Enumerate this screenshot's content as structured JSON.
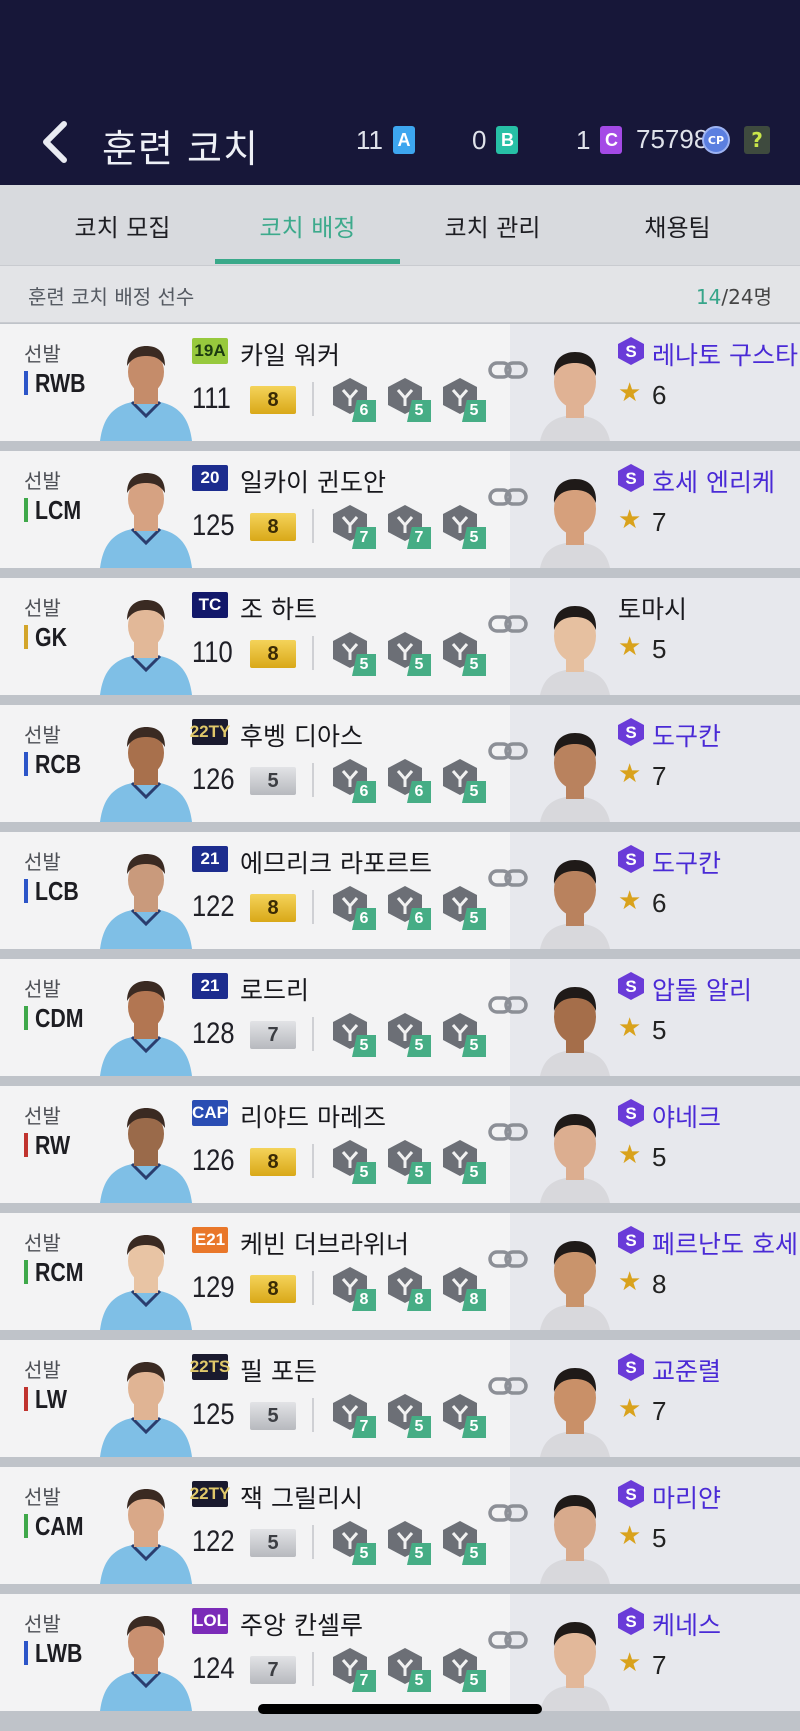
{
  "header": {
    "title": "훈련 코치",
    "currencies": [
      {
        "amount": "11",
        "token": "A"
      },
      {
        "amount": "0",
        "token": "B"
      },
      {
        "amount": "1",
        "token": "C"
      }
    ],
    "cp_amount": "75798",
    "cp_label": "CP",
    "help_label": "?"
  },
  "tabs": [
    "코치 모집",
    "코치 배정",
    "코치 관리",
    "채용팀"
  ],
  "active_tab": "코치 배정",
  "subbar": {
    "label": "훈련 코치 배정 선수",
    "assigned": "14",
    "total": "/24명"
  },
  "status_label": "선발",
  "players": [
    {
      "pos": "RWB",
      "pos_color": "#2c55c8",
      "season": "19A",
      "season_bg": "#97c93d",
      "season_fg": "#1b3a10",
      "name": "카일 워커",
      "ovr": "111",
      "level": "8",
      "level_type": "gold",
      "skills": [
        "6",
        "5",
        "5"
      ],
      "coach": "레나토 구스타",
      "coach_special": true,
      "coach_rating": "6"
    },
    {
      "pos": "LCM",
      "pos_color": "#3fa84a",
      "season": "20",
      "season_bg": "#1c2c8e",
      "season_fg": "#ffffff",
      "name": "일카이 귄도안",
      "ovr": "125",
      "level": "8",
      "level_type": "gold",
      "skills": [
        "7",
        "7",
        "5"
      ],
      "coach": "호세 엔리케",
      "coach_special": true,
      "coach_rating": "7"
    },
    {
      "pos": "GK",
      "pos_color": "#d3a52a",
      "season": "TC",
      "season_bg": "#12186a",
      "season_fg": "#ffffff",
      "name": "조 하트",
      "ovr": "110",
      "level": "8",
      "level_type": "gold",
      "skills": [
        "5",
        "5",
        "5"
      ],
      "coach": "토마시",
      "coach_special": false,
      "coach_rating": "5"
    },
    {
      "pos": "RCB",
      "pos_color": "#2c55c8",
      "season": "22TY",
      "season_bg": "#1a1a2e",
      "season_fg": "#e0c86a",
      "name": "후벵 디아스",
      "ovr": "126",
      "level": "5",
      "level_type": "silver",
      "skills": [
        "6",
        "6",
        "5"
      ],
      "coach": "도구칸",
      "coach_special": true,
      "coach_rating": "7"
    },
    {
      "pos": "LCB",
      "pos_color": "#2c55c8",
      "season": "21",
      "season_bg": "#1c2c8e",
      "season_fg": "#ffffff",
      "name": "에므리크 라포르트",
      "ovr": "122",
      "level": "8",
      "level_type": "gold",
      "skills": [
        "6",
        "6",
        "5"
      ],
      "coach": "도구칸",
      "coach_special": true,
      "coach_rating": "6"
    },
    {
      "pos": "CDM",
      "pos_color": "#3fa84a",
      "season": "21",
      "season_bg": "#1c2c8e",
      "season_fg": "#ffffff",
      "name": "로드리",
      "ovr": "128",
      "level": "7",
      "level_type": "silver",
      "skills": [
        "5",
        "5",
        "5"
      ],
      "coach": "압둘 알리",
      "coach_special": true,
      "coach_rating": "5"
    },
    {
      "pos": "RW",
      "pos_color": "#c0332e",
      "season": "CAP",
      "season_bg": "#2a4db3",
      "season_fg": "#ffffff",
      "name": "리야드 마레즈",
      "ovr": "126",
      "level": "8",
      "level_type": "gold",
      "skills": [
        "5",
        "5",
        "5"
      ],
      "coach": "야네크",
      "coach_special": true,
      "coach_rating": "5"
    },
    {
      "pos": "RCM",
      "pos_color": "#3fa84a",
      "season": "E21",
      "season_bg": "#e9772a",
      "season_fg": "#ffffff",
      "name": "케빈 더브라위너",
      "ovr": "129",
      "level": "8",
      "level_type": "gold",
      "skills": [
        "8",
        "8",
        "8"
      ],
      "coach": "페르난도 호세",
      "coach_special": true,
      "coach_rating": "8"
    },
    {
      "pos": "LW",
      "pos_color": "#c0332e",
      "season": "22TS",
      "season_bg": "#1a1a2e",
      "season_fg": "#e0c86a",
      "name": "필 포든",
      "ovr": "125",
      "level": "5",
      "level_type": "silver",
      "skills": [
        "7",
        "5",
        "5"
      ],
      "coach": "교준렬",
      "coach_special": true,
      "coach_rating": "7"
    },
    {
      "pos": "CAM",
      "pos_color": "#3fa84a",
      "season": "22TY",
      "season_bg": "#1a1a2e",
      "season_fg": "#e0c86a",
      "name": "잭 그릴리시",
      "ovr": "122",
      "level": "5",
      "level_type": "silver",
      "skills": [
        "5",
        "5",
        "5"
      ],
      "coach": "마리얀",
      "coach_special": true,
      "coach_rating": "5"
    },
    {
      "pos": "LWB",
      "pos_color": "#2c55c8",
      "season": "LOL",
      "season_bg": "#7b2bb8",
      "season_fg": "#ffffff",
      "name": "주앙 칸셀루",
      "ovr": "124",
      "level": "7",
      "level_type": "silver",
      "skills": [
        "7",
        "5",
        "5"
      ],
      "coach": "케네스",
      "coach_special": true,
      "coach_rating": "7"
    }
  ]
}
